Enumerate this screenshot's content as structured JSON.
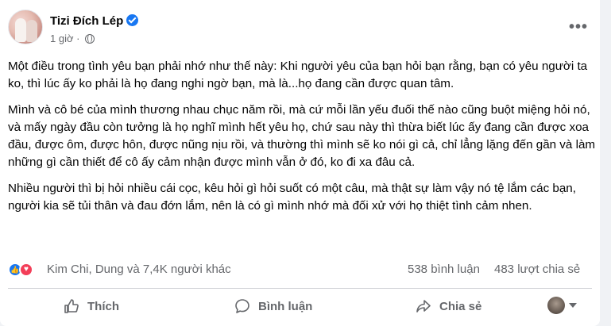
{
  "post": {
    "author": "Tizi Đích Lép",
    "time": "1 giờ",
    "more": "•••",
    "paragraphs": [
      "Một điều trong tình yêu bạn phải nhớ như thế này: Khi người yêu của bạn hỏi bạn rằng, bạn có yêu người ta ko, thì lúc ấy ko phải là họ đang nghi ngờ bạn, mà là...họ đang cần được quan tâm.",
      "Mình và cô bé của mình thương nhau chục năm rồi, mà cứ mỗi lần yếu đuối thế nào cũng buột miệng hỏi nó, và mấy ngày đầu còn tưởng là họ nghĩ mình hết yêu họ, chứ sau này thì thừa biết lúc ấy đang cần được xoa đầu, được ôm, được hôn, được nũng nịu rồi, và thường thì mình sẽ ko nói gì cả, chỉ lẳng lặng đến gần và làm những gì cần thiết để cô ấy cảm nhận được mình vẫn ở đó, ko đi xa đâu cả.",
      "Nhiều người thì bị hỏi nhiều cái cọc, kêu hỏi gì hỏi suốt có một câu, mà thật sự làm vậy nó tệ lắm các bạn, người kia sẽ tủi thân và đau đớn lắm, nên là có gì mình nhớ mà đối xử với họ thiệt tình cảm nhen."
    ]
  },
  "stats": {
    "reactors": "Kim Chi, Dung và 7,4K người khác",
    "comments": "538 bình luận",
    "shares": "483 lượt chia sẻ"
  },
  "actions": {
    "like": "Thích",
    "comment": "Bình luận",
    "share": "Chia sẻ"
  },
  "colors": {
    "accent": "#1877f2",
    "love": "#f33e58",
    "secondary_text": "#65676b"
  }
}
